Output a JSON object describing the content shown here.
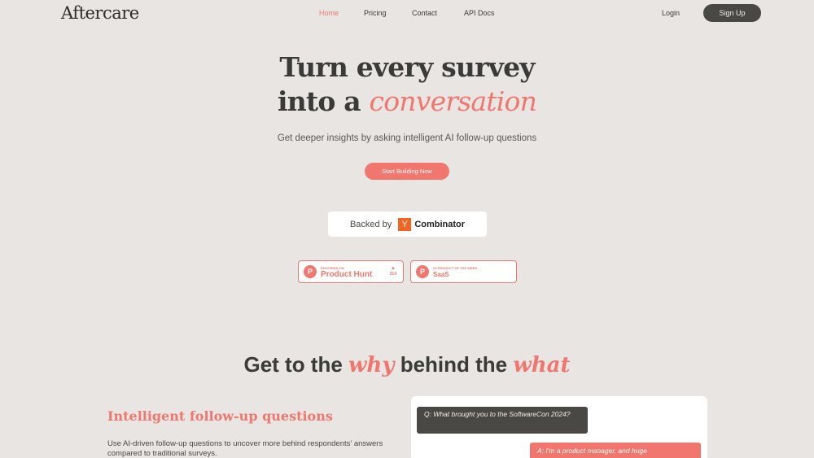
{
  "nav": {
    "logo": "Aftercare",
    "links": [
      "Home",
      "Pricing",
      "Contact",
      "API Docs"
    ],
    "login": "Login",
    "signup": "Sign Up"
  },
  "hero": {
    "line1": "Turn every survey",
    "line2_plain": "into a",
    "line2_accent": "conversation",
    "subtitle": "Get deeper insights by asking intelligent AI follow-up questions",
    "cta": "Start Building Now"
  },
  "backed": {
    "prefix": "Backed by",
    "yc_letter": "Y",
    "name": "Combinator"
  },
  "badges": [
    {
      "small": "FEATURED ON",
      "big": "Product Hunt",
      "count": "314",
      "logo": "P"
    },
    {
      "small": "#3 PRODUCT OF THE WEEK",
      "big": "SaaS",
      "logo": "P"
    }
  ],
  "section": {
    "t1": "Get to the",
    "t2": "why",
    "t3": "behind the",
    "t4": "what"
  },
  "feature": {
    "title": "Intelligent follow-up questions",
    "desc": "Use AI-driven follow-up questions to uncover more behind respondents' answers compared to traditional surveys."
  },
  "chat": {
    "question": "Q: What brought you to the SoftwareCon 2024?",
    "answer": "A: I'm a product manager, and huge"
  },
  "colors": {
    "accent": "#f0766e",
    "dark": "#4a4844",
    "background": "#e8e5e2"
  }
}
